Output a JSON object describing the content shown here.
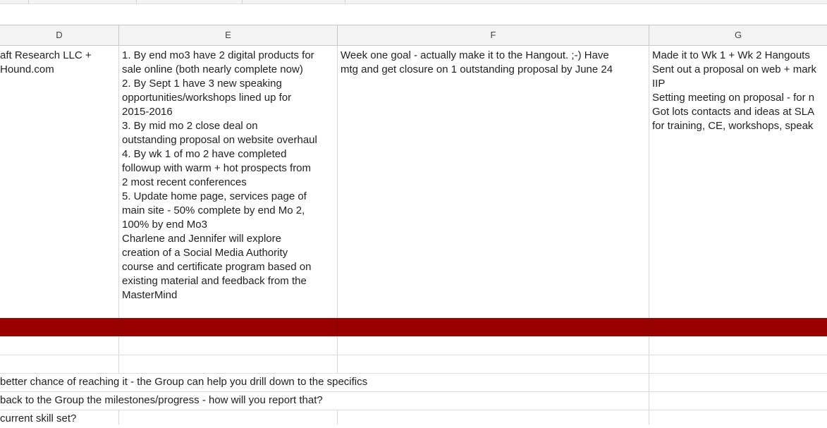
{
  "columns": [
    "D",
    "E",
    "F",
    "G"
  ],
  "row1": {
    "d": "aft Research LLC  +\nHound.com",
    "e": "1. By end mo3 have 2 digital products for\nsale online (both nearly complete now)\n2. By Sept 1 have 3 new speaking\nopportunities/workshops lined up for\n2015-2016\n3. By mid mo 2 close deal on\noutstanding proposal on website overhaul\n4. By wk 1 of mo 2 have completed\nfollowup with warm + hot prospects from\n2 most recent conferences\n5. Update home page, services page of\nmain site - 50% complete by end Mo 2,\n100% by end Mo3\nCharlene and Jennifer will explore\ncreation of a Social Media Authority\ncourse and certificate program based on\nexisting material and feedback from the\nMasterMind",
    "f": "Week one goal - actually make it to the Hangout.  ;-)  Have\nmtg and get closure on 1 outstanding proposal by June 24",
    "g": "Made it to Wk 1 + Wk 2 Hangouts\nSent out a proposal on web + mark\nIIP\nSetting meeting on proposal - for n\nGot lots contacts and ideas at SLA\nfor training, CE, workshops, speak"
  },
  "prompts": [
    " better chance of reaching it - the Group can help you drill down to the specifics",
    "back to the Group the milestones/progress - how will you report that?",
    "current skill set?"
  ]
}
